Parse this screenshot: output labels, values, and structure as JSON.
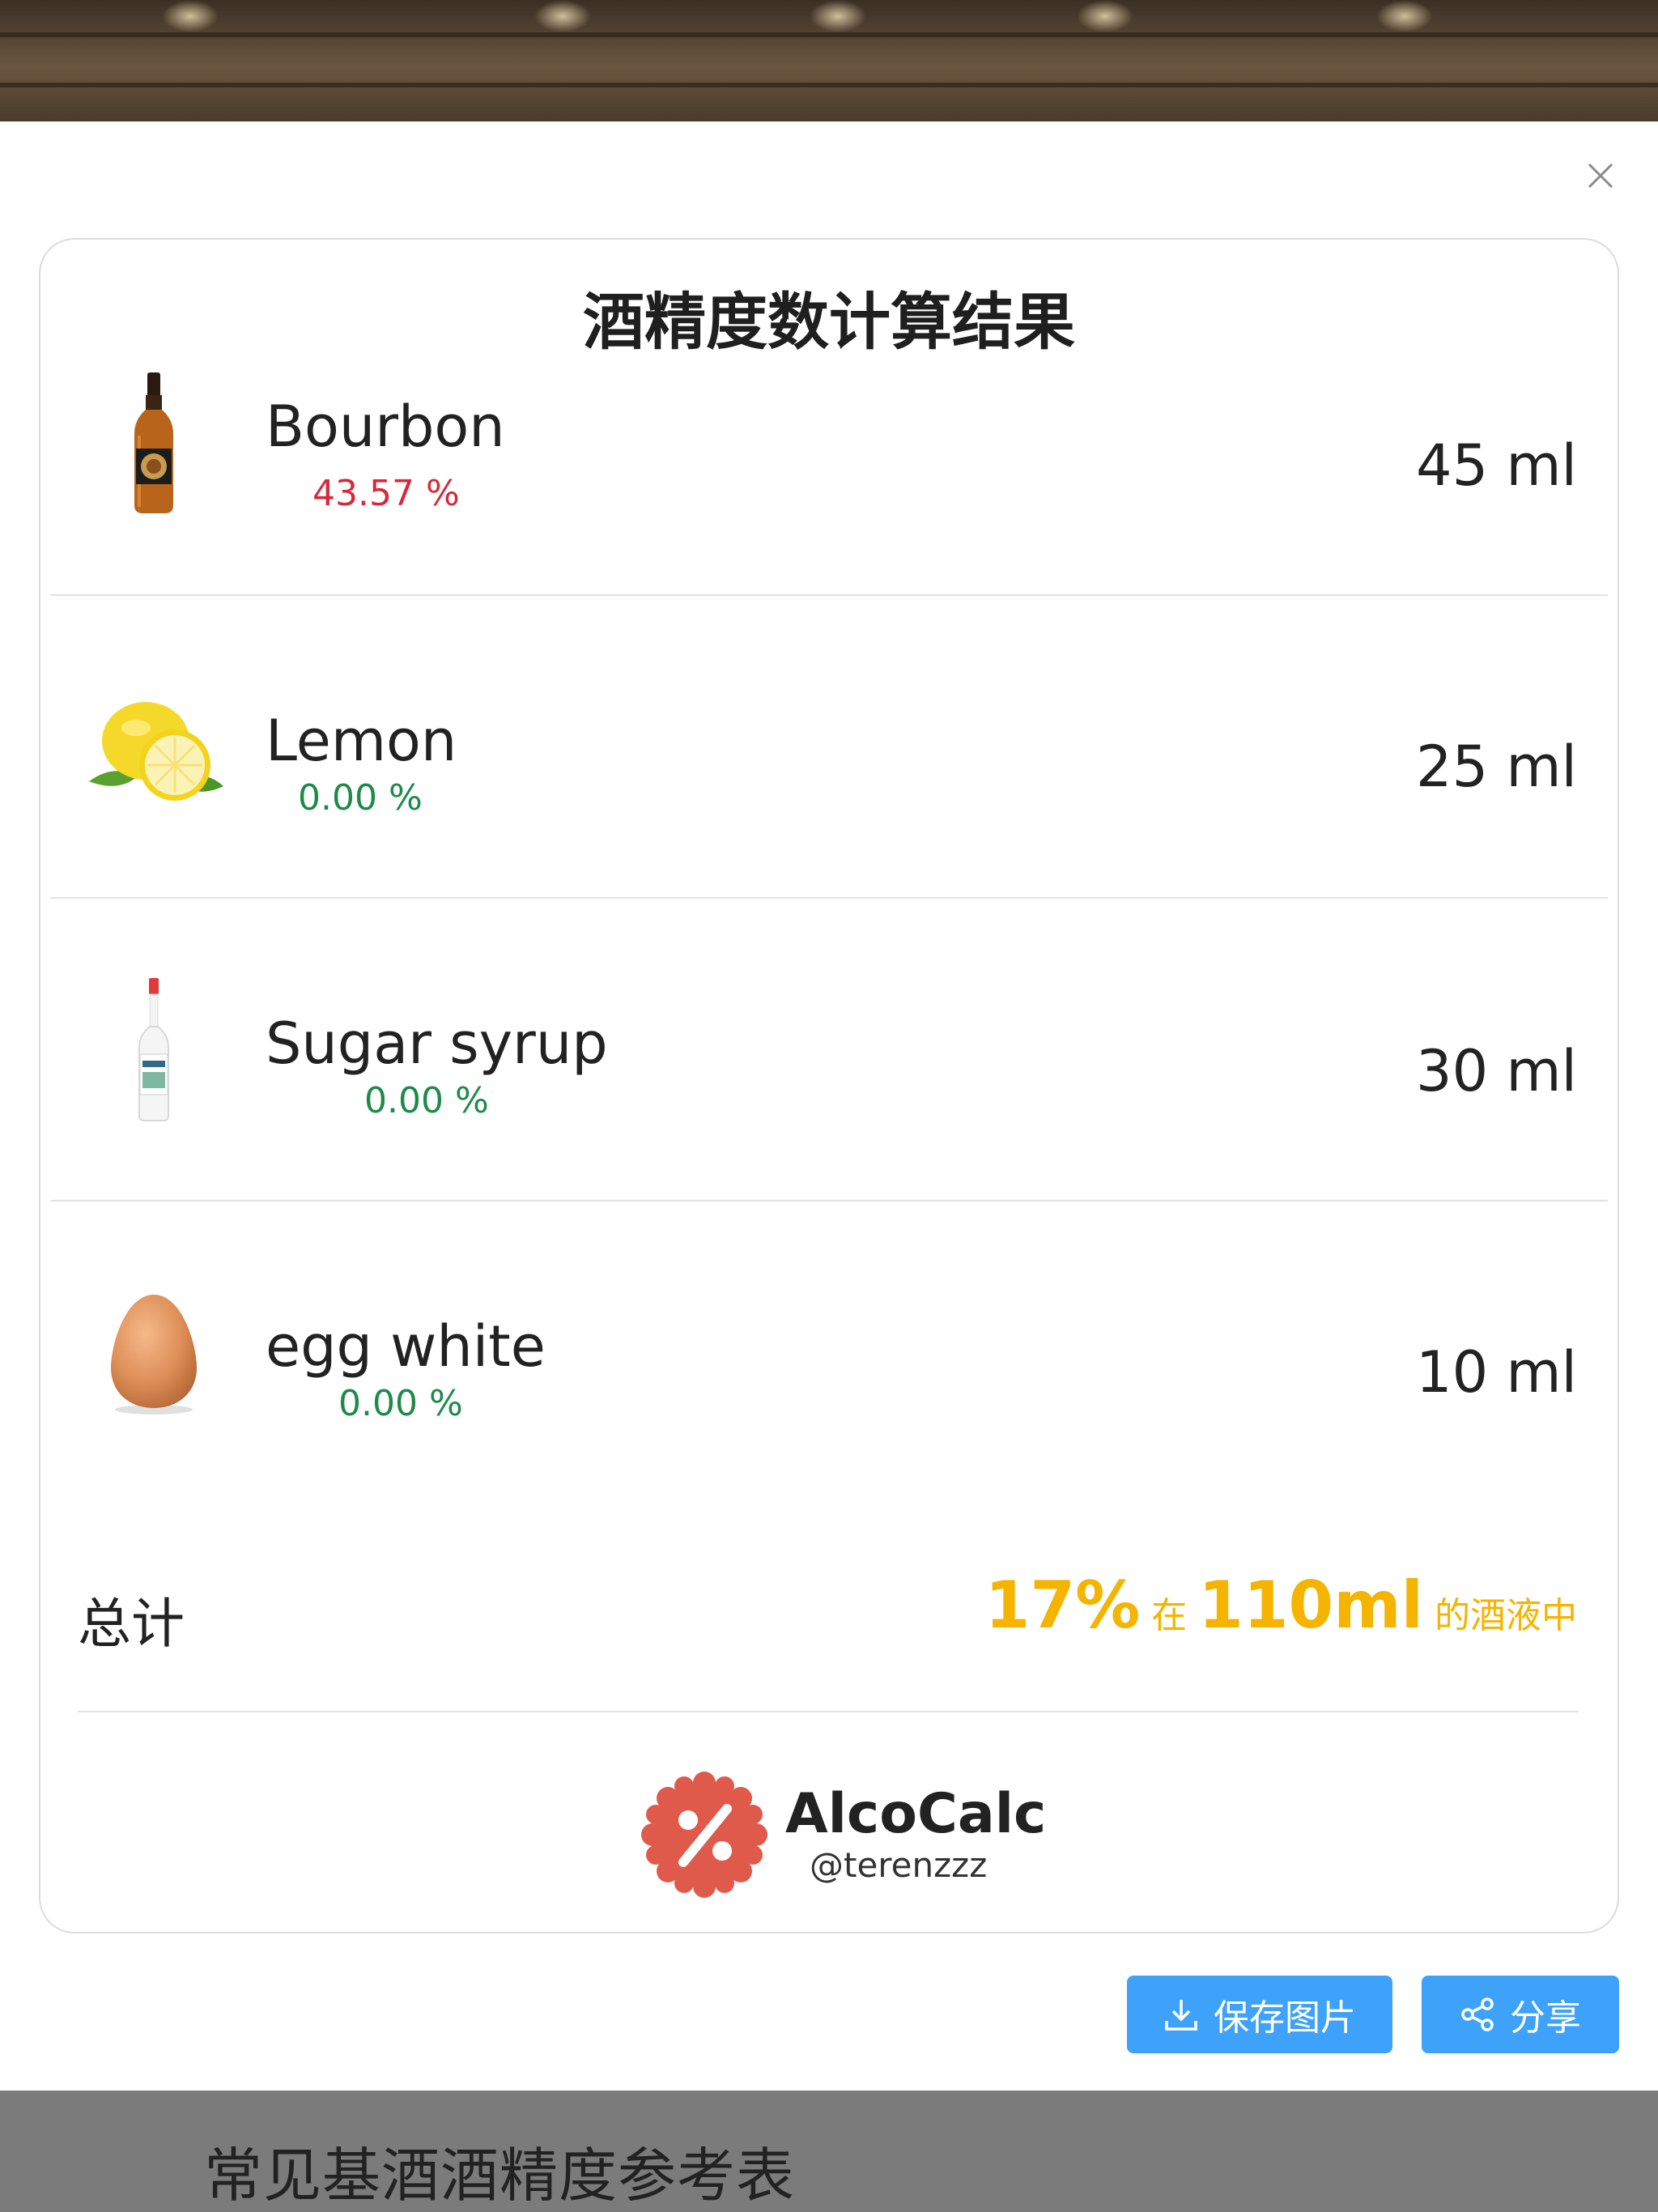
{
  "modal": {
    "title": "酒精度数计算结果",
    "close_icon": "close-icon"
  },
  "items": [
    {
      "name": "Bourbon",
      "abv": "43.57 %",
      "volume": "45 ml",
      "icon": "bourbon-bottle-icon",
      "abv_color": "#d6293c"
    },
    {
      "name": "Lemon",
      "abv": "0.00 %",
      "volume": "25 ml",
      "icon": "lemon-icon",
      "abv_color": "#1e8a49"
    },
    {
      "name": "Sugar syrup",
      "abv": "0.00 %",
      "volume": "30 ml",
      "icon": "syrup-bottle-icon",
      "abv_color": "#1e8a49"
    },
    {
      "name": "egg white",
      "abv": "0.00 %",
      "volume": "10 ml",
      "icon": "egg-icon",
      "abv_color": "#1e8a49"
    }
  ],
  "total": {
    "label": "总计",
    "abv": "17%",
    "in": "在",
    "volume": "110ml",
    "suffix": "的酒液中",
    "color": "#f5b400"
  },
  "brand": {
    "name": "AlcoCalc",
    "handle": "@terenzzz",
    "logo_icon": "percent-badge-icon",
    "logo_color": "#e05a4b"
  },
  "buttons": {
    "save_label": "保存图片",
    "save_icon": "download-icon",
    "share_label": "分享",
    "share_icon": "share-icon",
    "color": "#3ea2fb"
  },
  "background": {
    "section_title": "常见基酒酒精度参考表"
  }
}
